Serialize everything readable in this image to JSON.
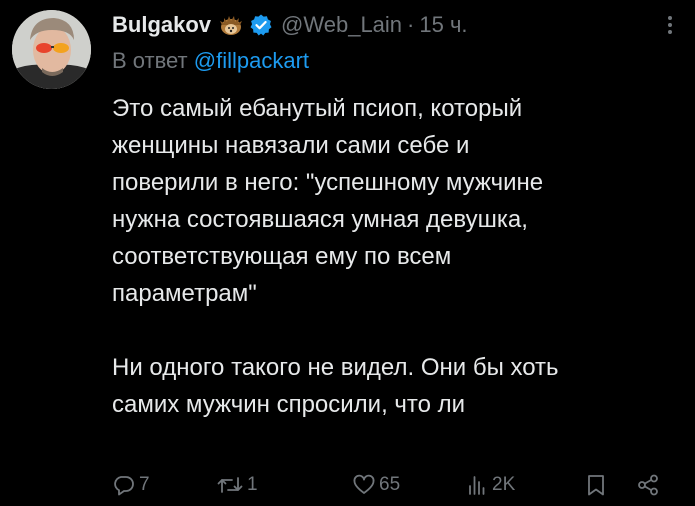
{
  "author": {
    "display_name": "Bulgakov",
    "name_emoji": "hedgehog-emoji",
    "verified_icon": "verified-badge-icon",
    "handle": "@Web_Lain",
    "separator": "·",
    "time": "15 ч."
  },
  "reply_to": {
    "prefix": "В ответ",
    "mention": "@fillpackart"
  },
  "body": {
    "lines_block1": [
      "Это самый ебанутый псиоп, который",
      "женщины навязали сами себе и",
      "поверили в него: \"успешному мужчине",
      "нужна состоявшаяся умная девушка,",
      "соответствующая ему по всем",
      "параметрам\""
    ],
    "lines_block2": [
      "Ни одного такого не видел. Они бы хоть",
      "самих мужчин спросили, что ли"
    ]
  },
  "actions": {
    "reply_count": "7",
    "retweet_count": "1",
    "like_count": "65",
    "views_count": "2K"
  },
  "colors": {
    "background": "#000000",
    "text": "#e7e9ea",
    "muted": "#71767b",
    "accent": "#1d9bf0"
  }
}
